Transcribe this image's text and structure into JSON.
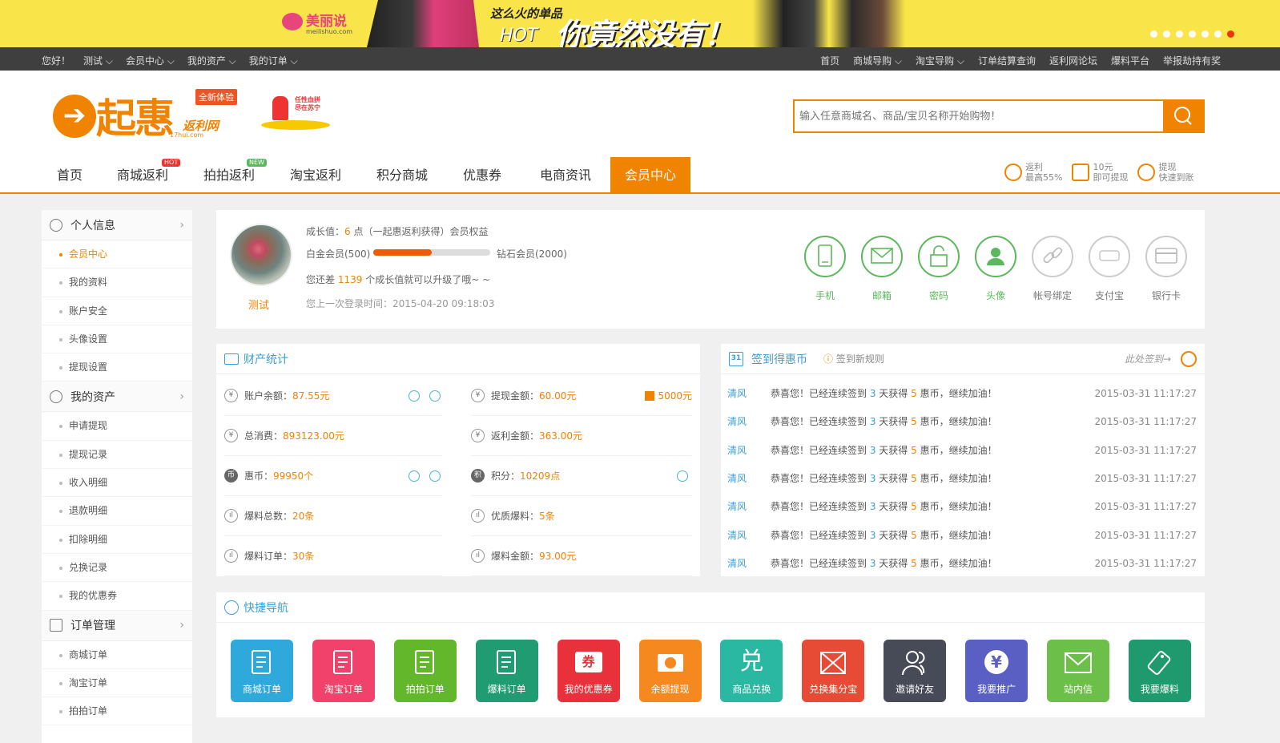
{
  "banner": {
    "brand": "美丽说",
    "brand_url": "meilishuo.com",
    "slogan_top": "这么火的单品",
    "slogan_hot": "HOT",
    "slogan_main": "你竟然没有！",
    "slide_count": 7,
    "active_slide": 7
  },
  "topbar": {
    "greeting": "您好！",
    "user_menu": "测试 ⌵",
    "member_center": "会员中心 ⌵",
    "my_assets": "我的资产 ⌵",
    "my_orders": "我的订单 ⌵",
    "right": [
      "首页",
      "商城导购 ⌵",
      "淘宝导购 ⌵",
      "订单结算查询",
      "返利网论坛",
      "爆料平台",
      "举报劫持有奖"
    ]
  },
  "logo": {
    "name": "起惠",
    "sub": "返利网",
    "domain": "17hui.com",
    "badge": "全新体验",
    "promo_text": "任性血拼 尽在苏宁"
  },
  "search": {
    "placeholder": "输入任意商城名、商品/宝贝名称开始购物！"
  },
  "nav": {
    "items": [
      "首页",
      "商城返利",
      "拍拍返利",
      "淘宝返利",
      "积分商城",
      "优惠券",
      "电商资讯",
      "会员中心"
    ],
    "hot_tag": "HOT",
    "new_tag": "NEW"
  },
  "perks": [
    {
      "l1": "返利",
      "l2": "最高55%"
    },
    {
      "l1": "10元",
      "l2": "即可提现"
    },
    {
      "l1": "提现",
      "l2": "快速到账"
    }
  ],
  "sidebar": {
    "groups": [
      {
        "title": "个人信息",
        "items": [
          "会员中心",
          "我的资料",
          "账户安全",
          "头像设置",
          "提现设置"
        ]
      },
      {
        "title": "我的资产",
        "items": [
          "申请提现",
          "提现记录",
          "收入明细",
          "退款明细",
          "扣除明细",
          "兑换记录",
          "我的优惠券"
        ]
      },
      {
        "title": "订单管理",
        "items": [
          "商城订单",
          "淘宝订单",
          "拍拍订单"
        ]
      }
    ],
    "arrow": "›"
  },
  "profile": {
    "username": "测试",
    "growth_label": "成长值：",
    "growth_value": "6",
    "growth_suffix": "点（一起惠返利获得）会员权益",
    "level_from": "白金会员(500)",
    "level_to": "钻石会员(2000)",
    "progress": 0.5,
    "gap_prefix": "您还差 ",
    "gap_value": "1139",
    "gap_suffix": " 个成长值就可以升级了哦~ ~",
    "last_login": "您上一次登录时间：2015-04-20 09:18:03",
    "security": [
      {
        "label": "手机",
        "icon": "phone-icon",
        "done": true
      },
      {
        "label": "邮箱",
        "icon": "mail-icon",
        "done": true
      },
      {
        "label": "密码",
        "icon": "lock-icon",
        "done": true
      },
      {
        "label": "头像",
        "icon": "user-icon",
        "done": true
      },
      {
        "label": "帐号绑定",
        "icon": "link-icon",
        "done": false
      },
      {
        "label": "支付宝",
        "icon": "alipay-icon",
        "done": false
      },
      {
        "label": "银行卡",
        "icon": "bankcard-icon",
        "done": false
      }
    ]
  },
  "assets": {
    "title": "财产统计",
    "rows": [
      {
        "label": "账户余额：",
        "value": "87.55元",
        "icon": "¥"
      },
      {
        "label": "提现金额：",
        "value": "60.00元",
        "icon": "¥",
        "extra": "5000元"
      },
      {
        "label": "总消费：",
        "value": "893123.00元",
        "icon": "¥"
      },
      {
        "label": "返利金额：",
        "value": "363.00元",
        "icon": "¥"
      },
      {
        "label": "惠币：",
        "value": "99950个",
        "icon": "币"
      },
      {
        "label": "积分：",
        "value": "10209点",
        "icon": "积"
      },
      {
        "label": "爆料总数：",
        "value": "20条",
        "icon": "ıl"
      },
      {
        "label": "优质爆料：",
        "value": "5条",
        "icon": "ıl"
      },
      {
        "label": "爆料订单：",
        "value": "30条",
        "icon": "ıl"
      },
      {
        "label": "爆料金额：",
        "value": "93.00元",
        "icon": "ıl"
      }
    ]
  },
  "checkin": {
    "title": "签到得惠币",
    "calendar_day": "31",
    "rules": "签到新规则",
    "hint": "此处签到→",
    "rows": [
      {
        "user": "清风",
        "msg_a": "恭喜您！已经连续签到 ",
        "days": "3",
        "msg_b": " 天获得 ",
        "coins": "5",
        "msg_c": " 惠币，继续加油！",
        "time": "2015-03-31 11:17:27"
      },
      {
        "user": "清风",
        "msg_a": "恭喜您！已经连续签到 ",
        "days": "3",
        "msg_b": " 天获得 ",
        "coins": "5",
        "msg_c": " 惠币，继续加油！",
        "time": "2015-03-31 11:17:27"
      },
      {
        "user": "清风",
        "msg_a": "恭喜您！已经连续签到 ",
        "days": "3",
        "msg_b": " 天获得 ",
        "coins": "5",
        "msg_c": " 惠币，继续加油！",
        "time": "2015-03-31 11:17:27"
      },
      {
        "user": "清风",
        "msg_a": "恭喜您！已经连续签到 ",
        "days": "3",
        "msg_b": " 天获得 ",
        "coins": "5",
        "msg_c": " 惠币，继续加油！",
        "time": "2015-03-31 11:17:27"
      },
      {
        "user": "清风",
        "msg_a": "恭喜您！已经连续签到 ",
        "days": "3",
        "msg_b": " 天获得 ",
        "coins": "5",
        "msg_c": " 惠币，继续加油！",
        "time": "2015-03-31 11:17:27"
      },
      {
        "user": "清风",
        "msg_a": "恭喜您！已经连续签到 ",
        "days": "3",
        "msg_b": " 天获得 ",
        "coins": "5",
        "msg_c": " 惠币，继续加油！",
        "time": "2015-03-31 11:17:27"
      },
      {
        "user": "清风",
        "msg_a": "恭喜您！已经连续签到 ",
        "days": "3",
        "msg_b": " 天获得 ",
        "coins": "5",
        "msg_c": " 惠币，继续加油！",
        "time": "2015-03-31 11:17:27"
      }
    ]
  },
  "quick": {
    "title": "快捷导航",
    "items": [
      {
        "label": "商城订单",
        "color": "#2fa8dc",
        "glyph": "doc"
      },
      {
        "label": "淘宝订单",
        "color": "#f0426b",
        "glyph": "doc"
      },
      {
        "label": "拍拍订单",
        "color": "#62b82a",
        "glyph": "doc"
      },
      {
        "label": "爆料订单",
        "color": "#219c72",
        "glyph": "doc"
      },
      {
        "label": "我的优惠券",
        "color": "#e8313a",
        "glyph": "coupon"
      },
      {
        "label": "余额提现",
        "color": "#f5891f",
        "glyph": "cash"
      },
      {
        "label": "商品兑换",
        "color": "#2ab8a3",
        "glyph": "exchange"
      },
      {
        "label": "兑换集分宝",
        "color": "#e84b35",
        "glyph": "envelope"
      },
      {
        "label": "邀请好友",
        "color": "#474b57",
        "glyph": "users"
      },
      {
        "label": "我要推广",
        "color": "#5a5fc4",
        "glyph": "yen"
      },
      {
        "label": "站内信",
        "color": "#6cc04a",
        "glyph": "mail"
      },
      {
        "label": "我要爆料",
        "color": "#1e9a6e",
        "glyph": "tag"
      }
    ],
    "exchange_char": "兑",
    "coupon_char": "券"
  }
}
